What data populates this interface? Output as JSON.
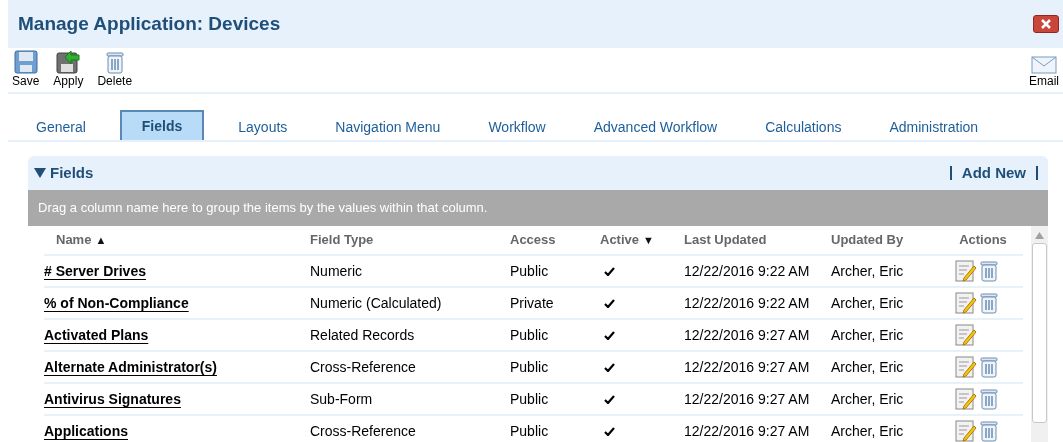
{
  "window": {
    "title": "Manage Application: Devices"
  },
  "toolbar": [
    {
      "label": "Save",
      "kind": "save"
    },
    {
      "label": "Apply",
      "kind": "apply"
    },
    {
      "label": "Delete",
      "kind": "delete"
    }
  ],
  "email": {
    "label": "Email"
  },
  "tabs": [
    {
      "label": "General",
      "selected": false
    },
    {
      "label": "Fields",
      "selected": true
    },
    {
      "label": "Layouts",
      "selected": false
    },
    {
      "label": "Navigation Menu",
      "selected": false
    },
    {
      "label": "Workflow",
      "selected": false
    },
    {
      "label": "Advanced Workflow",
      "selected": false
    },
    {
      "label": "Calculations",
      "selected": false
    },
    {
      "label": "Administration",
      "selected": false
    }
  ],
  "panel": {
    "title": "Fields",
    "expanded": true,
    "add_new": "Add New",
    "group_hint": "Drag a column name here to group the items by the values within that column."
  },
  "table": {
    "columns": [
      {
        "label": "Name",
        "sort_arrow": "▲"
      },
      {
        "label": "Field Type"
      },
      {
        "label": "Access"
      },
      {
        "label": "Active",
        "sort_arrow": "▼"
      },
      {
        "label": "Last Updated"
      },
      {
        "label": "Updated By"
      },
      {
        "label": "Actions"
      }
    ],
    "rows": [
      {
        "name": "# Server Drives",
        "field_type": "Numeric",
        "access": "Public",
        "active": true,
        "last_updated": "12/22/2016 9:22 AM",
        "updated_by": "Archer, Eric",
        "deletable": true
      },
      {
        "name": "% of Non-Compliance",
        "field_type": "Numeric (Calculated)",
        "access": "Private",
        "active": true,
        "last_updated": "12/22/2016 9:22 AM",
        "updated_by": "Archer, Eric",
        "deletable": true
      },
      {
        "name": "Activated Plans",
        "field_type": "Related Records",
        "access": "Public",
        "active": true,
        "last_updated": "12/22/2016 9:27 AM",
        "updated_by": "Archer, Eric",
        "deletable": false
      },
      {
        "name": "Alternate Administrator(s)",
        "field_type": "Cross-Reference",
        "access": "Public",
        "active": true,
        "last_updated": "12/22/2016 9:27 AM",
        "updated_by": "Archer, Eric",
        "deletable": true
      },
      {
        "name": "Antivirus Signatures",
        "field_type": "Sub-Form",
        "access": "Public",
        "active": true,
        "last_updated": "12/22/2016 9:27 AM",
        "updated_by": "Archer, Eric",
        "deletable": true
      },
      {
        "name": "Applications",
        "field_type": "Cross-Reference",
        "access": "Public",
        "active": true,
        "last_updated": "12/22/2016 9:27 AM",
        "updated_by": "Archer, Eric",
        "deletable": true
      }
    ]
  }
}
